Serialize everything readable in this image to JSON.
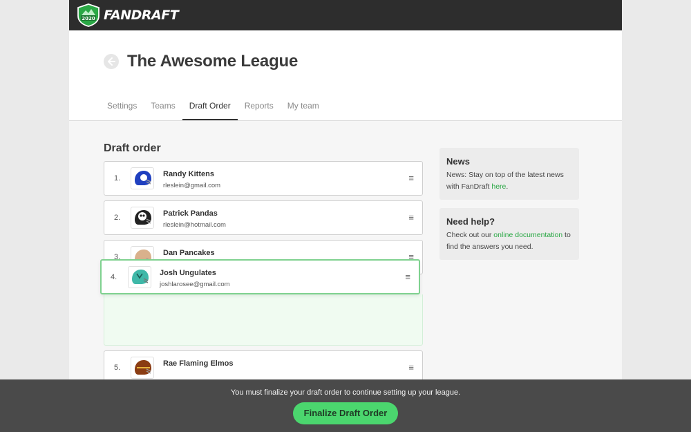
{
  "header": {
    "brand": "FANDRAFT",
    "logo_year": "2020"
  },
  "league": {
    "title": "The Awesome League",
    "back_icon": "arrow-left-icon"
  },
  "tabs": [
    {
      "label": "Settings"
    },
    {
      "label": "Teams"
    },
    {
      "label": "Draft Order",
      "active": true
    },
    {
      "label": "Reports"
    },
    {
      "label": "My team"
    }
  ],
  "draft": {
    "section_title": "Draft order",
    "handle_glyph": "≡",
    "rows": [
      {
        "num": "1.",
        "name": "Randy Kittens",
        "email": "rleslein@gmail.com",
        "helmet_color": "#1f3fbf"
      },
      {
        "num": "2.",
        "name": "Patrick Pandas",
        "email": "rleslein@hotmail.com",
        "helmet_color": "#222222"
      },
      {
        "num": "3.",
        "name": "Dan Pancakes",
        "email": "",
        "helmet_color": "#d9b18c"
      },
      {
        "num": "5.",
        "name": "Rae Flaming Elmos",
        "email": "",
        "helmet_color": "#8a3c12"
      }
    ],
    "dragging": {
      "num": "4.",
      "name": "Josh Ungulates",
      "email": "joshlarosee@gmail.com",
      "helmet_color": "#3fb8a8"
    }
  },
  "sidebar": {
    "news": {
      "title": "News",
      "text": "News: Stay on top of the latest news with FanDraft ",
      "link": "here",
      "after": "."
    },
    "help": {
      "title": "Need help?",
      "text": "Check out our ",
      "link": "online documentation",
      "after": " to find the answers you need."
    }
  },
  "footer": {
    "message": "You must finalize your draft order to continue setting up your league.",
    "button": "Finalize Draft Order"
  },
  "colors": {
    "accent": "#4bd66e",
    "topbar": "#2d2d2d",
    "footer": "#4a4a4a"
  }
}
